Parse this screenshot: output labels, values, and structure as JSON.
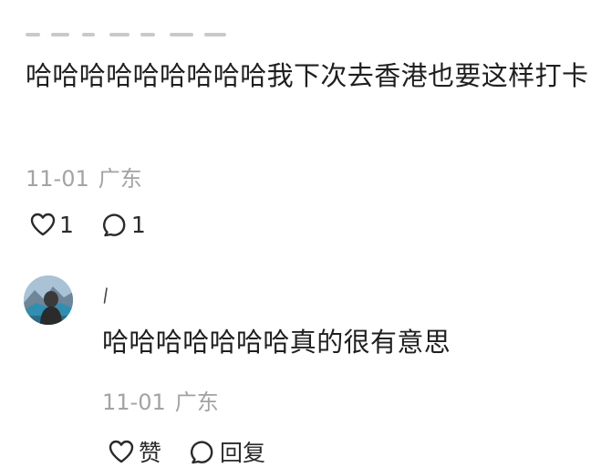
{
  "comment": {
    "text": "哈哈哈哈哈哈哈哈哈我下次去香港也要这样打卡",
    "date": "11-01",
    "location": "广东",
    "like_count": "1",
    "reply_count": "1"
  },
  "reply": {
    "text": "哈哈哈哈哈哈哈真的很有意思",
    "date": "11-01",
    "location": "广东",
    "like_label": "赞",
    "reply_label": "回复"
  },
  "icons": {
    "like": "heart-icon",
    "comment": "speech-bubble-icon"
  },
  "colors": {
    "text": "#1f1f1f",
    "meta": "#a3a3a3",
    "icon": "#2a2a2a"
  }
}
